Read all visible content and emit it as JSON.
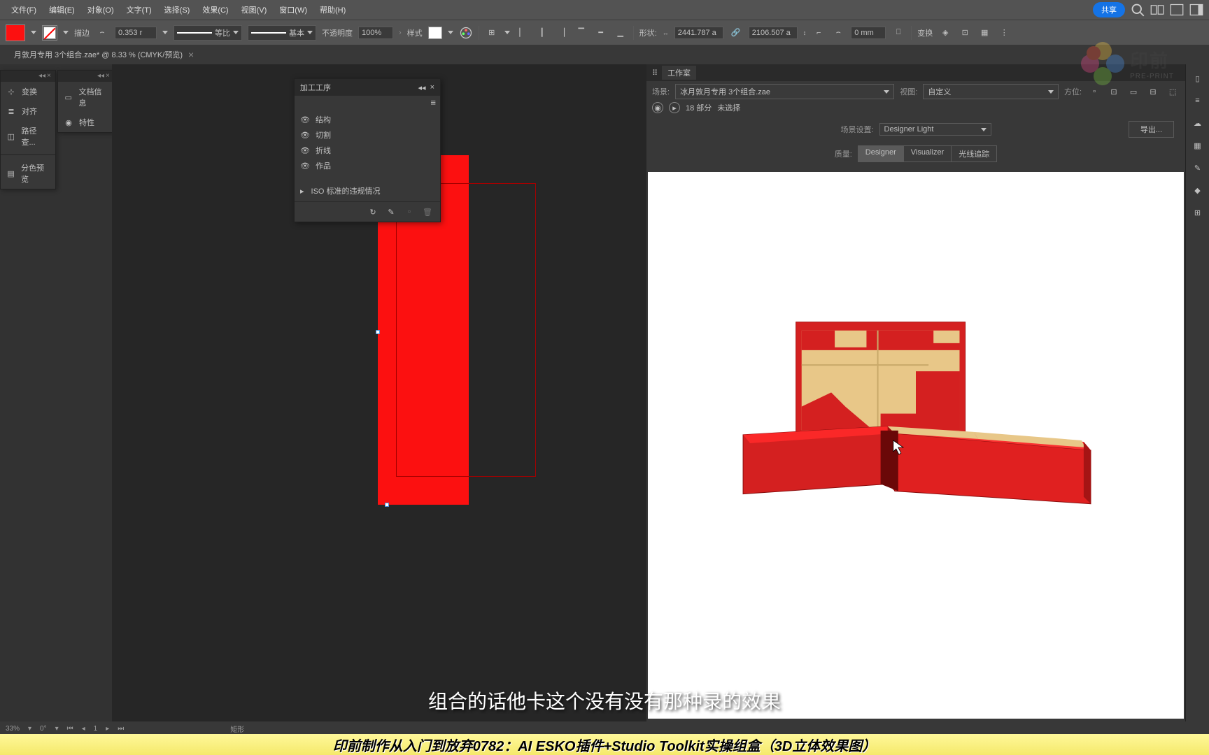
{
  "menubar": {
    "items": [
      "文件(F)",
      "编辑(E)",
      "对象(O)",
      "文字(T)",
      "选择(S)",
      "效果(C)",
      "视图(V)",
      "窗口(W)",
      "帮助(H)"
    ],
    "share": "共享"
  },
  "optionbar": {
    "stroke_label": "描边",
    "stroke_value": "0.353 r",
    "scale_label": "等比",
    "basic_label": "基本",
    "opacity_label": "不透明度",
    "opacity_value": "100%",
    "style_label": "样式",
    "shape_label": "形状:",
    "w_label": "宽:",
    "w_value": "2441.787 a",
    "h_value": "2106.507 a",
    "h_label": "高:",
    "extra_label": ":",
    "extra_value": "0 mm",
    "transform_label": "变换"
  },
  "tab": {
    "name": "月敦月专用 3个组合.zae* @ 8.33 % (CMYK/预览)"
  },
  "left_panels": {
    "g1": [
      "变换",
      "对齐",
      "路径查..."
    ],
    "g1_last": "分色预览",
    "g2": [
      "文档信息",
      "特性"
    ]
  },
  "float_panel": {
    "title": "加工工序",
    "rows": [
      "结构",
      "切割",
      "折线",
      "作品"
    ],
    "iso": "ISO 标准的违规情况"
  },
  "studio": {
    "title": "工作室",
    "scene_label": "场景:",
    "scene_value": "冰月敦月专用 3个组合.zae",
    "view_label": "视图:",
    "view_value": "自定义",
    "position_label": "方位:",
    "parts": "18 部分",
    "unselected": "未选择",
    "scene_settings_label": "场景设置:",
    "scene_settings_value": "Designer Light",
    "quality_label": "质量:",
    "quality_tabs": [
      "Designer",
      "Visualizer",
      "光线追踪"
    ],
    "export": "导出..."
  },
  "statusbar": {
    "zoom": "33%",
    "angle": "0°",
    "artboard": "1",
    "tool": "矩形"
  },
  "subtitle": "组合的话他卡这个没有没有那种录的效果",
  "title_banner": "印前制作从入门到放弃0782：AI ESKO插件+Studio Toolkit实操组盒（3D立体效果图）",
  "watermark": {
    "cn": "印前",
    "en": "PRE-PRINT"
  }
}
